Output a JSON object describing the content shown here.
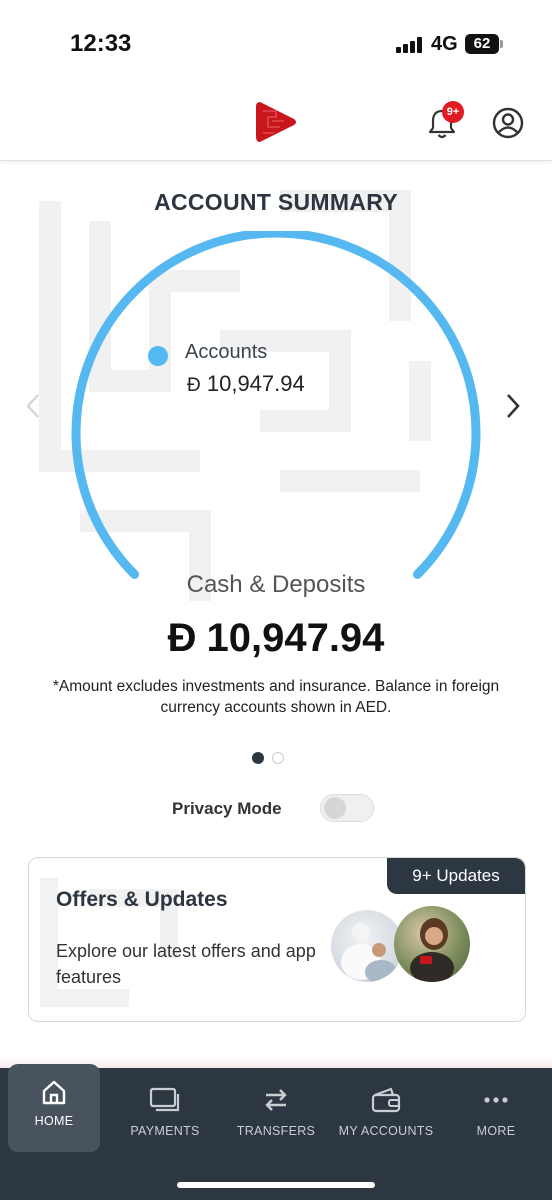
{
  "status_bar": {
    "time": "12:33",
    "network": "4G",
    "battery": "62"
  },
  "header": {
    "logo_icon": "bank-logo-icon",
    "notification_badge": "9+",
    "bell_icon": "bell-icon",
    "profile_icon": "profile-icon"
  },
  "summary": {
    "title": "ACCOUNT SUMMARY",
    "legend_label": "Accounts",
    "legend_amount": "10,947.94",
    "currency_symbol": "Đ",
    "category_label": "Cash & Deposits",
    "total_amount": "10,947.94",
    "note": "*Amount excludes investments and insurance. Balance in foreign currency accounts shown in AED.",
    "gauge_fill_fraction": 1.0,
    "gauge_color": "#56b8f0",
    "pager_total": 2,
    "pager_active": 1
  },
  "privacy": {
    "label": "Privacy Mode",
    "enabled": false
  },
  "offers": {
    "badge": "9+ Updates",
    "title": "Offers & Updates",
    "description": "Explore our latest offers and app features"
  },
  "tab_bar": {
    "tabs": [
      {
        "label": "HOME",
        "icon": "home-icon",
        "active": true
      },
      {
        "label": "PAYMENTS",
        "icon": "payments-icon",
        "active": false
      },
      {
        "label": "TRANSFERS",
        "icon": "transfers-icon",
        "active": false
      },
      {
        "label": "MY ACCOUNTS",
        "icon": "wallet-icon",
        "active": false
      },
      {
        "label": "MORE",
        "icon": "more-icon",
        "active": false
      }
    ]
  },
  "colors": {
    "accent_blue": "#56b8f0",
    "brand_red": "#e11b22",
    "tab_bar_bg": "#2d3741"
  }
}
